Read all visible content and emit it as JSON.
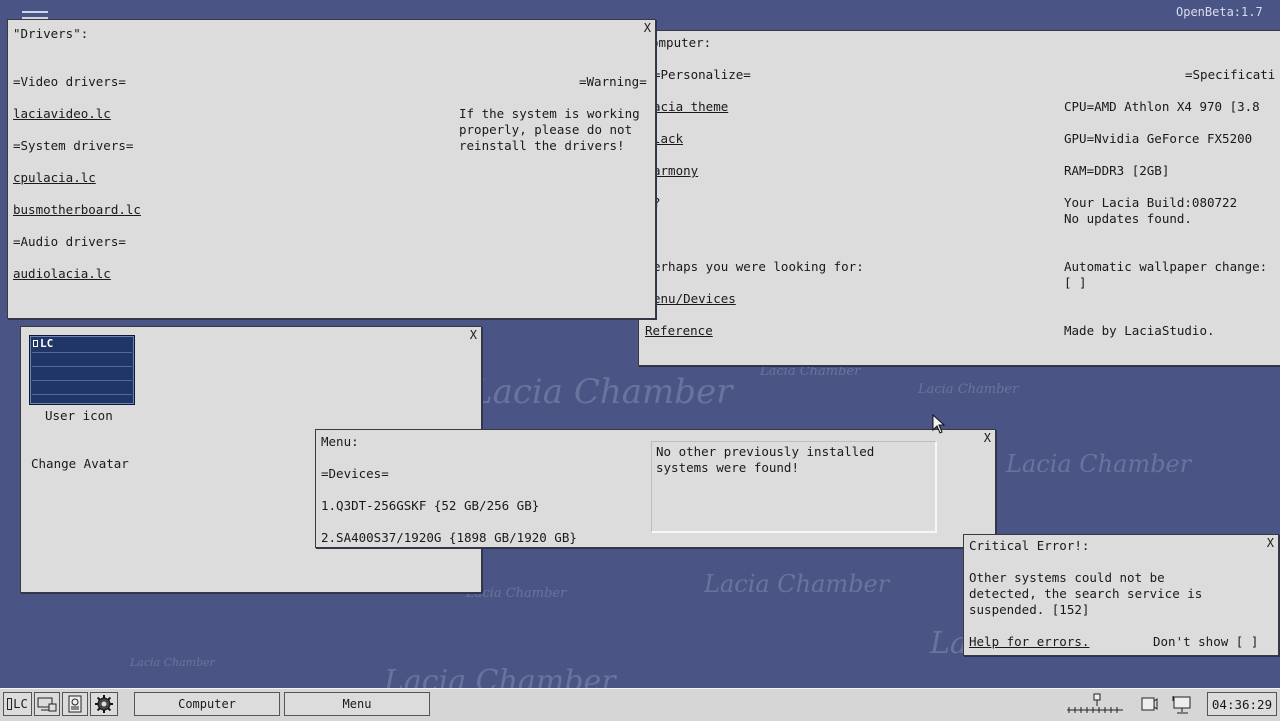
{
  "version_label": "OpenBeta:1.7",
  "watermark_text": "Lacia Chamber",
  "close_glyph": "X",
  "drivers_window": {
    "title": "\"Drivers\":",
    "video_header": "=Video drivers=",
    "video_item": "laciavideo.lc",
    "system_header": "=System drivers=",
    "system_items": [
      "cpulacia.lc",
      "busmotherboard.lc"
    ],
    "audio_header": "=Audio drivers=",
    "audio_item": "audiolacia.lc",
    "warning_header": "=Warning=",
    "warning_text": "If the system is working\nproperly, please do not\nreinstall the drivers!"
  },
  "computer_window": {
    "title": "omputer:",
    "personalize_header": "=Personalize=",
    "personalize_items": [
      "acia theme",
      "lack",
      "armony",
      "?"
    ],
    "looking_for": "erhaps you were looking for:",
    "links": [
      "enu/Devices",
      "Reference"
    ],
    "spec_header": "=Specificati",
    "cpu": "CPU=AMD Athlon X4 970 [3.8",
    "gpu": "GPU=Nvidia GeForce FX5200",
    "ram": "RAM=DDR3 [2GB]",
    "build": "Your Lacia Build:080722",
    "updates": "No updates found.",
    "wallpaper_label": "Automatic wallpaper change:",
    "wallpaper_checkbox": "[ ]",
    "credit": "Made by LaciaStudio."
  },
  "user_window": {
    "avatar_label": "LC",
    "user_icon_label": "User icon",
    "change_avatar": "Change Avatar"
  },
  "menu_window": {
    "title": "Menu:",
    "devices_header": "=Devices=",
    "devices": [
      "1.Q3DT-256GSKF {52 GB/256 GB}",
      "2.SA400S37/1920G {1898 GB/1920 GB}"
    ],
    "notice": "No other previously installed\nsystems were found!"
  },
  "error_window": {
    "title": "Critical Error!:",
    "message": "Other systems could not be\ndetected, the search service is\nsuspended. [152]",
    "help_link": "Help for errors.",
    "dont_show": "Don't show [ ]"
  },
  "taskbar": {
    "start_label": "LC",
    "tasks": [
      "Computer",
      "Menu"
    ],
    "clock": "04:36:29",
    "icons": [
      "start-icon",
      "display-settings-icon",
      "document-icon",
      "gear-icon",
      "volume-slider-icon",
      "speaker-icon",
      "network-icon"
    ]
  },
  "colors": {
    "desktop": "#4a5585",
    "window": "#dcdcdc",
    "avatar": "#1f3666"
  }
}
